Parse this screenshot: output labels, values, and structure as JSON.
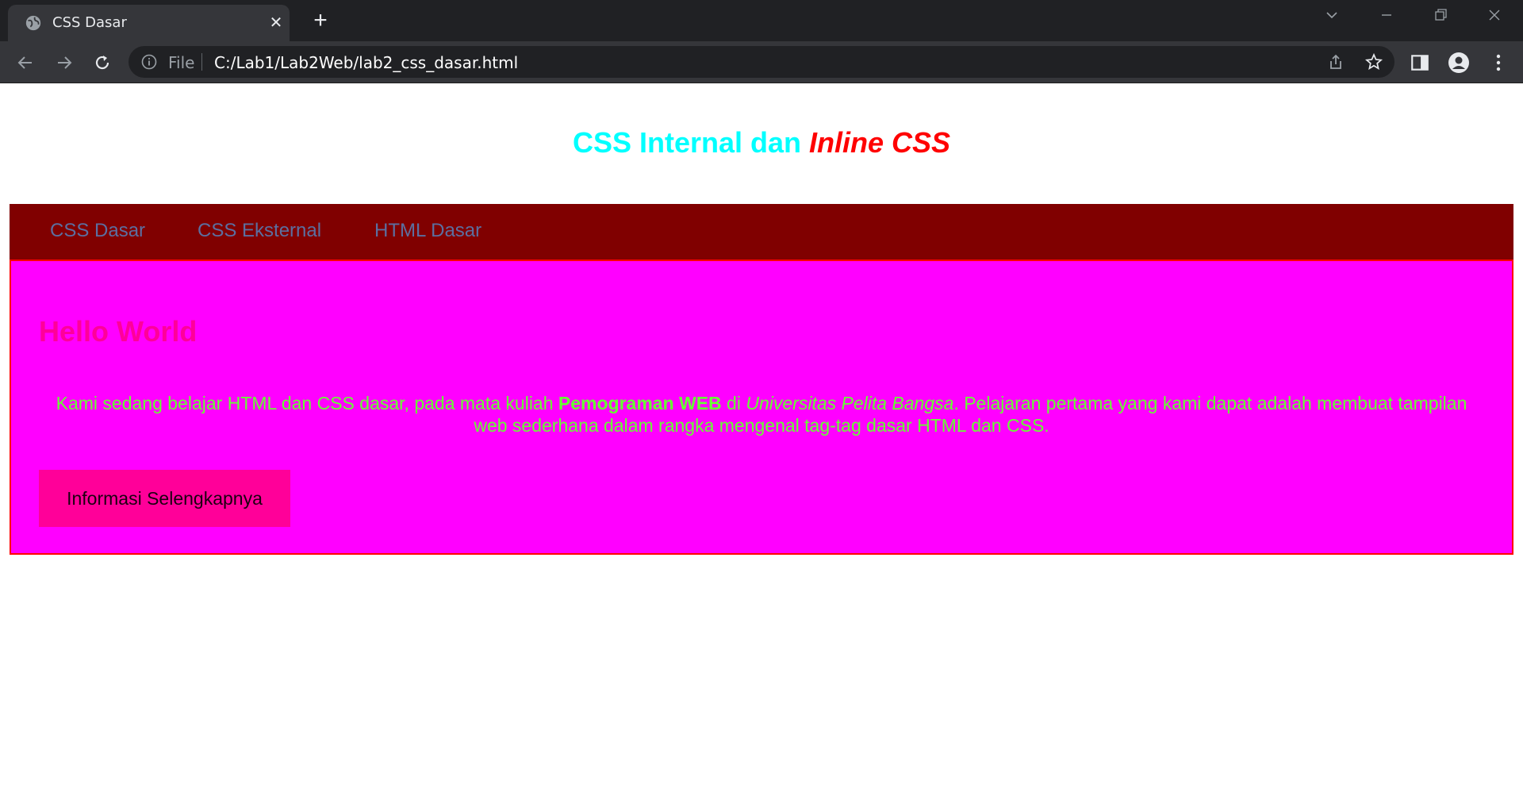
{
  "browser": {
    "tab_title": "CSS Dasar",
    "new_tab_symbol": "+",
    "close_symbol": "✕",
    "scheme_label": "File",
    "url": "C:/Lab1/Lab2Web/lab2_css_dasar.html"
  },
  "page": {
    "heading_main": "CSS Internal dan ",
    "heading_accent": "Inline CSS",
    "nav": [
      {
        "label": "CSS Dasar"
      },
      {
        "label": "CSS Eksternal"
      },
      {
        "label": "HTML Dasar"
      }
    ],
    "section_title": "Hello World",
    "paragraph": {
      "part1": "Kami sedang belajar HTML dan CSS dasar, pada mata kuliah ",
      "bold": "Pemograman WEB",
      "part2": " di ",
      "italic": "Universitas Pelita Bangsa",
      "part3": ". Pelajaran pertama yang kami dapat adalah membuat tampilan web sederhana dalam rangka mengenal tag-tag dasar HTML dan CSS."
    },
    "button_label": "Informasi Selengkapnya"
  },
  "colors": {
    "heading": "#00ffff",
    "heading_accent": "#ff0000",
    "navbar_bg": "#800000",
    "nav_link": "#5b6fa0",
    "content_bg": "#ff00ff",
    "content_border": "#ff0000",
    "section_title": "#ff0099",
    "paragraph": "#66ff33",
    "button_bg": "#ff0099"
  }
}
